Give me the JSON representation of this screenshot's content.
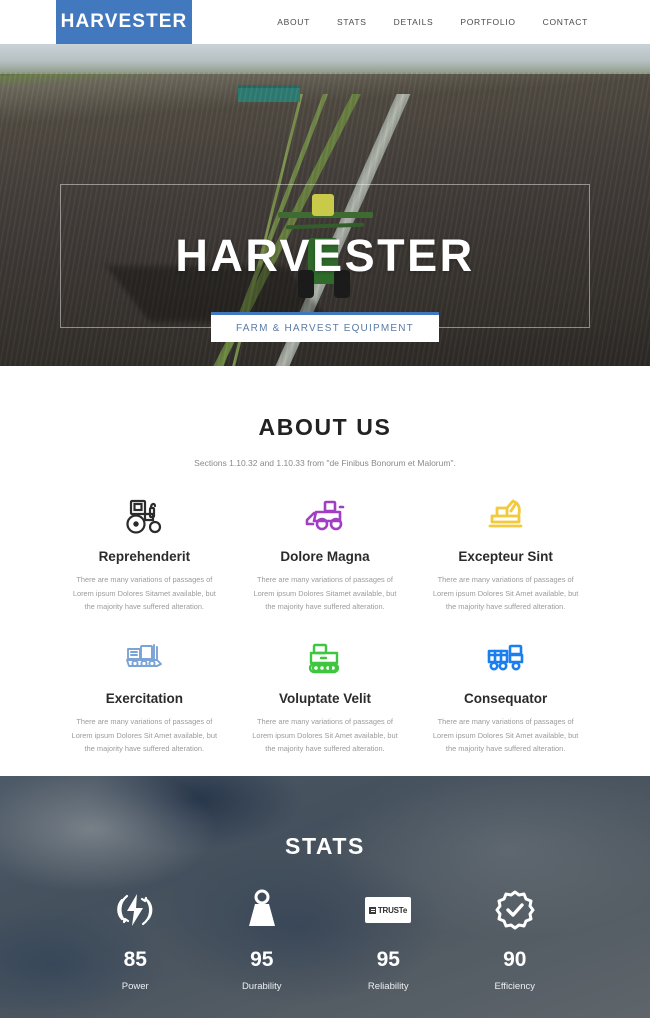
{
  "header": {
    "logo": "HARVESTER",
    "nav": [
      {
        "label": "ABOUT"
      },
      {
        "label": "STATS"
      },
      {
        "label": "DETAILS"
      },
      {
        "label": "PORTFOLIO"
      },
      {
        "label": "CONTACT"
      }
    ]
  },
  "hero": {
    "title": "HARVESTER",
    "button_label": "FARM & HARVEST EQUIPMENT",
    "accent_color": "#4178be"
  },
  "about": {
    "title": "ABOUT US",
    "subtitle": "Sections 1.10.32 and 1.10.33 from \"de Finibus Bonorum et Malorum\".",
    "features": [
      {
        "icon": "tractor-icon",
        "icon_color": "#2b2b2b",
        "title": "Reprehenderit",
        "desc": "There are many variations of passages of Lorem ipsum Dolores Sitamet available, but the majority have suffered alteration."
      },
      {
        "icon": "bulldozer-icon",
        "icon_color": "#a03fc4",
        "title": "Dolore Magna",
        "desc": "There are many variations of passages of Lorem ipsum Dolores Sitamet available, but the majority have suffered alteration."
      },
      {
        "icon": "excavator-icon",
        "icon_color": "#f2ca3c",
        "title": "Excepteur Sint",
        "desc": "There are many variations of passages of Lorem ipsum Dolores Sit Amet available, but the majority have suffered alteration."
      },
      {
        "icon": "crawler-tractor-icon",
        "icon_color": "#7ba3d6",
        "title": "Exercitation",
        "desc": "There are many variations of passages of Lorem ipsum Dolores Sit Amet available, but the majority have suffered alteration."
      },
      {
        "icon": "tracked-loader-icon",
        "icon_color": "#3ec63e",
        "title": "Voluptate Velit",
        "desc": "There are many variations of passages of Lorem ipsum Dolores Sit Amet available, but the majority have suffered alteration."
      },
      {
        "icon": "harvester-icon",
        "icon_color": "#1b7ef0",
        "title": "Consequator",
        "desc": "There are many variations of passages of Lorem ipsum Dolores Sit Amet available, but the majority have suffered alteration."
      }
    ]
  },
  "stats": {
    "title": "STATS",
    "items": [
      {
        "icon": "power-bolt-icon",
        "value": "85",
        "label": "Power"
      },
      {
        "icon": "weight-icon",
        "value": "95",
        "label": "Durability"
      },
      {
        "icon": "truste-badge-icon",
        "value": "95",
        "label": "Reliability",
        "badge_text": "TRUSTe"
      },
      {
        "icon": "gear-check-icon",
        "value": "90",
        "label": "Efficiency"
      }
    ]
  }
}
